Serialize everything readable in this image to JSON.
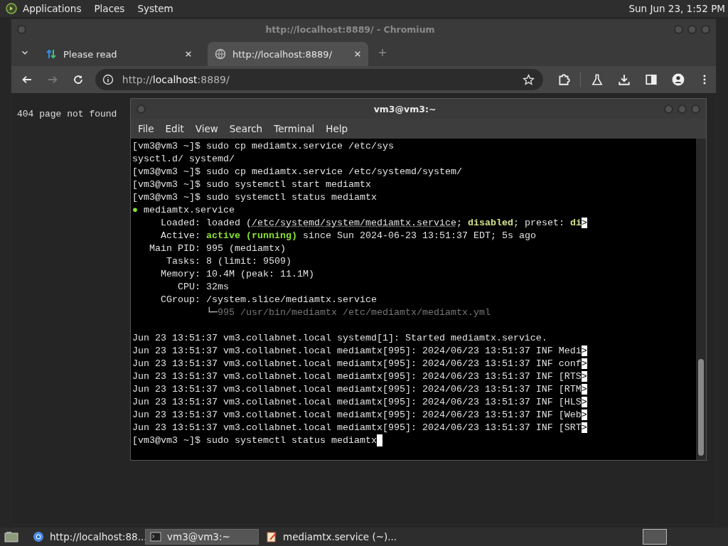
{
  "top_panel": {
    "menus": [
      "Applications",
      "Places",
      "System"
    ],
    "clock": "Sun Jun 23, 1:52 PM"
  },
  "browser": {
    "title": "http://localhost:8889/ - Chromium",
    "tabs": [
      {
        "label": "Please read",
        "selected": false
      },
      {
        "label": "http://localhost:8889/",
        "selected": true
      }
    ],
    "address": {
      "prefix": "http://",
      "host": "localhost",
      "suffix": ":8889/"
    },
    "page_text": "404 page not found"
  },
  "terminal": {
    "title": "vm3@vm3:~",
    "menus": [
      "File",
      "Edit",
      "View",
      "Search",
      "Terminal",
      "Help"
    ],
    "lines": [
      {
        "segments": [
          {
            "kind": "normal",
            "text": "[vm3@vm3 ~]$ sudo cp mediamtx.service /etc/sys"
          }
        ]
      },
      {
        "segments": [
          {
            "kind": "normal",
            "text": "sysctl.d/ systemd/"
          }
        ]
      },
      {
        "segments": [
          {
            "kind": "normal",
            "text": "[vm3@vm3 ~]$ sudo cp mediamtx.service /etc/systemd/system/"
          }
        ]
      },
      {
        "segments": [
          {
            "kind": "normal",
            "text": "[vm3@vm3 ~]$ sudo systemctl start mediamtx"
          }
        ]
      },
      {
        "segments": [
          {
            "kind": "normal",
            "text": "[vm3@vm3 ~]$ sudo systemctl status mediamtx"
          }
        ]
      },
      {
        "segments": [
          {
            "kind": "bullet",
            "text": "●"
          },
          {
            "kind": "normal",
            "text": " mediamtx.service"
          }
        ]
      },
      {
        "segments": [
          {
            "kind": "normal",
            "text": "     Loaded: loaded ("
          },
          {
            "kind": "link",
            "text": "/etc/systemd/system/mediamtx.service"
          },
          {
            "kind": "normal",
            "text": "; "
          },
          {
            "kind": "bold-yellow",
            "text": "disabled"
          },
          {
            "kind": "normal",
            "text": "; preset: "
          },
          {
            "kind": "bold-yellow",
            "text": "di"
          },
          {
            "kind": "more",
            "text": ">"
          }
        ]
      },
      {
        "segments": [
          {
            "kind": "normal",
            "text": "     Active: "
          },
          {
            "kind": "bold-green",
            "text": "active (running)"
          },
          {
            "kind": "normal",
            "text": " since Sun 2024-06-23 13:51:37 EDT; 5s ago"
          }
        ]
      },
      {
        "segments": [
          {
            "kind": "normal",
            "text": "   Main PID: 995 (mediamtx)"
          }
        ]
      },
      {
        "segments": [
          {
            "kind": "normal",
            "text": "      Tasks: 8 (limit: 9509)"
          }
        ]
      },
      {
        "segments": [
          {
            "kind": "normal",
            "text": "     Memory: 10.4M (peak: 11.1M)"
          }
        ]
      },
      {
        "segments": [
          {
            "kind": "normal",
            "text": "        CPU: 32ms"
          }
        ]
      },
      {
        "segments": [
          {
            "kind": "normal",
            "text": "     CGroup: /system.slice/mediamtx.service"
          }
        ]
      },
      {
        "segments": [
          {
            "kind": "normal",
            "text": "             └─"
          },
          {
            "kind": "dim",
            "text": "995 /usr/bin/mediamtx /etc/mediamtx/mediamtx.yml"
          }
        ]
      },
      {
        "gap_before": true,
        "segments": [
          {
            "kind": "normal",
            "text": "Jun 23 13:51:37 vm3.collabnet.local systemd[1]: Started mediamtx.service."
          }
        ]
      },
      {
        "segments": [
          {
            "kind": "normal",
            "text": "Jun 23 13:51:37 vm3.collabnet.local mediamtx[995]: 2024/06/23 13:51:37 INF Medi"
          },
          {
            "kind": "more",
            "text": ">"
          }
        ]
      },
      {
        "segments": [
          {
            "kind": "normal",
            "text": "Jun 23 13:51:37 vm3.collabnet.local mediamtx[995]: 2024/06/23 13:51:37 INF conf"
          },
          {
            "kind": "more",
            "text": ">"
          }
        ]
      },
      {
        "segments": [
          {
            "kind": "normal",
            "text": "Jun 23 13:51:37 vm3.collabnet.local mediamtx[995]: 2024/06/23 13:51:37 INF [RTS"
          },
          {
            "kind": "more",
            "text": ">"
          }
        ]
      },
      {
        "segments": [
          {
            "kind": "normal",
            "text": "Jun 23 13:51:37 vm3.collabnet.local mediamtx[995]: 2024/06/23 13:51:37 INF [RTM"
          },
          {
            "kind": "more",
            "text": ">"
          }
        ]
      },
      {
        "segments": [
          {
            "kind": "normal",
            "text": "Jun 23 13:51:37 vm3.collabnet.local mediamtx[995]: 2024/06/23 13:51:37 INF [HLS"
          },
          {
            "kind": "more",
            "text": ">"
          }
        ]
      },
      {
        "segments": [
          {
            "kind": "normal",
            "text": "Jun 23 13:51:37 vm3.collabnet.local mediamtx[995]: 2024/06/23 13:51:37 INF [Web"
          },
          {
            "kind": "more",
            "text": ">"
          }
        ]
      },
      {
        "segments": [
          {
            "kind": "normal",
            "text": "Jun 23 13:51:37 vm3.collabnet.local mediamtx[995]: 2024/06/23 13:51:37 INF [SRT"
          },
          {
            "kind": "more",
            "text": ">"
          }
        ]
      },
      {
        "cursor": true,
        "segments": [
          {
            "kind": "normal",
            "text": "[vm3@vm3 ~]$ sudo systemctl status mediamtx"
          }
        ]
      }
    ]
  },
  "taskbar": {
    "tasks": [
      {
        "label": "http://localhost:88...",
        "kind": "browser",
        "selected": false
      },
      {
        "label": "vm3@vm3:~",
        "kind": "terminal",
        "selected": true
      },
      {
        "label": "mediamtx.service (~)...",
        "kind": "editor",
        "selected": false
      }
    ]
  }
}
